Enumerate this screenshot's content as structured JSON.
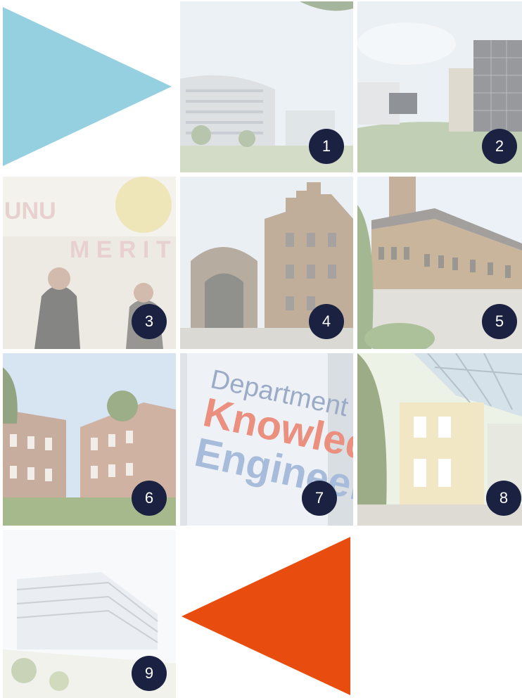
{
  "colors": {
    "badge": "#1b2140",
    "triangle_left": "#94d0e0",
    "triangle_right": "#e84c0e"
  },
  "tiles": [
    {
      "number": "1",
      "scene": "curved-building"
    },
    {
      "number": "2",
      "scene": "modern-glass-building"
    },
    {
      "number": "3",
      "scene": "students-entrance"
    },
    {
      "number": "4",
      "scene": "historic-gate"
    },
    {
      "number": "5",
      "scene": "brick-tower-building"
    },
    {
      "number": "6",
      "scene": "courtyard-buildings"
    },
    {
      "number": "7",
      "scene": "department-sign"
    },
    {
      "number": "8",
      "scene": "atrium"
    },
    {
      "number": "9",
      "scene": "new-building-render"
    }
  ],
  "sign": {
    "line1": "Department of",
    "line2": "Knowledge",
    "line3": "Engineering"
  }
}
